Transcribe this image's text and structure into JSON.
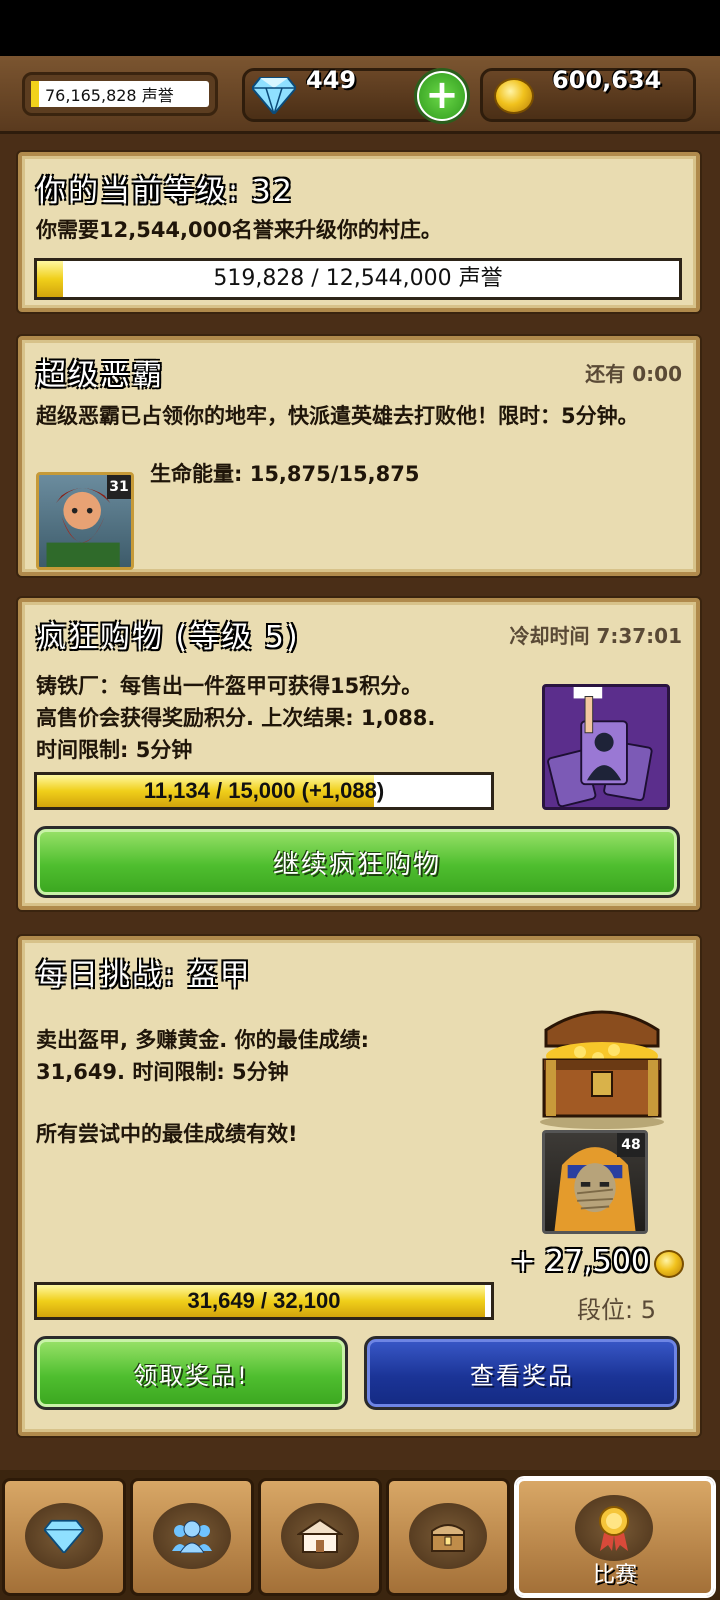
{
  "top_bar": {
    "prestige": "76,165,828 声誉",
    "gems": "449",
    "gold": "600,634"
  },
  "level_panel": {
    "title": "你的当前等级: 32",
    "description": "你需要12,544,000名誉来升级你的村庄。",
    "progress_label": "519,828 / 12,544,000 声誉",
    "progress_fraction": 0.041
  },
  "boss_panel": {
    "title": "超级恶霸",
    "time_left": "还有 0:00",
    "description": "超级恶霸已占领你的地牢，快派遣英雄去打败他！限时：5分钟。",
    "hero_level": "31",
    "life_energy": "生命能量: 15,875/15,875"
  },
  "frenzy_panel": {
    "title": "疯狂购物 (等级 5)",
    "cooldown": "冷却时间 7:37:01",
    "line1": "铸铁厂：每售出一件盔甲可获得15积分。",
    "line2": "高售价会获得奖励积分. 上次结果: 1,088.",
    "line3": "时间限制: 5分钟",
    "progress_label": "11,134 / 15,000 (+1,088)",
    "progress_fraction": 0.742,
    "continue_button": "继续疯狂购物"
  },
  "daily_panel": {
    "title": "每日挑战: 盔甲",
    "line1": "卖出盔甲, 多赚黄金. 你的最佳成绩:",
    "line2": "31,649. 时间限制: 5分钟",
    "line3": "所有尝试中的最佳成绩有效!",
    "opponent_level": "48",
    "reward": "+ 27,500",
    "rank": "段位: 5",
    "progress_label": "31,649 / 32,100",
    "progress_fraction": 0.986,
    "claim_button": "领取奖品!",
    "view_button": "查看奖品"
  },
  "bottom_nav": {
    "tabs": [
      {
        "icon": "gem-icon"
      },
      {
        "icon": "heroes-icon"
      },
      {
        "icon": "village-icon"
      },
      {
        "icon": "chest-icon"
      },
      {
        "icon": "medal-icon",
        "label": "比赛"
      }
    ]
  }
}
